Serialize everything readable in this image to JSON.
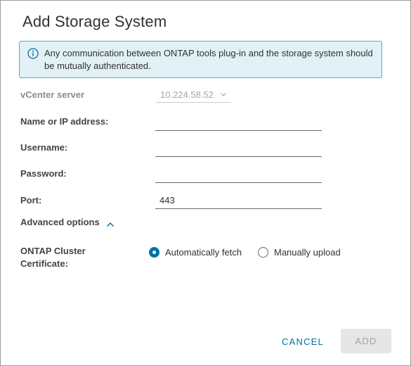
{
  "dialog": {
    "title": "Add Storage System"
  },
  "alert": {
    "icon": "info-icon",
    "text": "Any communication between ONTAP tools plug-in and the storage system should be mutually authenticated.",
    "color_border": "#49afd9",
    "color_bg": "#e1f1f6"
  },
  "form": {
    "vcenter": {
      "label": "vCenter server",
      "value": "10.224.58.52"
    },
    "name_ip": {
      "label": "Name or IP address:",
      "value": ""
    },
    "username": {
      "label": "Username:",
      "value": ""
    },
    "password": {
      "label": "Password:",
      "value": ""
    },
    "port": {
      "label": "Port:",
      "value": "443"
    }
  },
  "advanced": {
    "label": "Advanced options",
    "expanded": true
  },
  "certificate": {
    "label": "ONTAP Cluster Certificate:",
    "options": [
      {
        "label": "Automatically fetch",
        "checked": true
      },
      {
        "label": "Manually upload",
        "checked": false
      }
    ]
  },
  "footer": {
    "cancel_label": "CANCEL",
    "add_label": "ADD",
    "add_disabled": true
  },
  "colors": {
    "accent": "#0072a3"
  }
}
